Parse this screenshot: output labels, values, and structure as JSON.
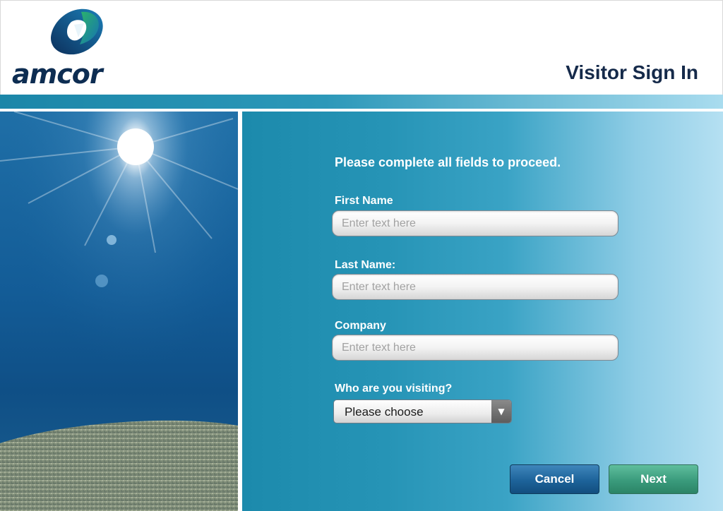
{
  "brand": {
    "logo_text": "amcor"
  },
  "header": {
    "title": "Visitor Sign In"
  },
  "form": {
    "instruction": "Please complete all fields to proceed.",
    "first_name": {
      "label": "First Name",
      "placeholder": "Enter text here",
      "value": ""
    },
    "last_name": {
      "label": "Last Name:",
      "placeholder": "Enter text here",
      "value": ""
    },
    "company": {
      "label": "Company",
      "placeholder": "Enter text here",
      "value": ""
    },
    "visiting": {
      "label": "Who are you visiting?",
      "selected": "Please choose",
      "arrow_icon": "▼"
    }
  },
  "buttons": {
    "cancel": "Cancel",
    "next": "Next"
  },
  "colors": {
    "title": "#152a4a",
    "stripe": "#1b86a8",
    "panel": "#2694b6",
    "cancel_button": "#1d639a",
    "next_button": "#3a9b7c"
  },
  "icons": {
    "logo": "amcor-logo-mark",
    "dropdown": "chevron-down-icon"
  }
}
